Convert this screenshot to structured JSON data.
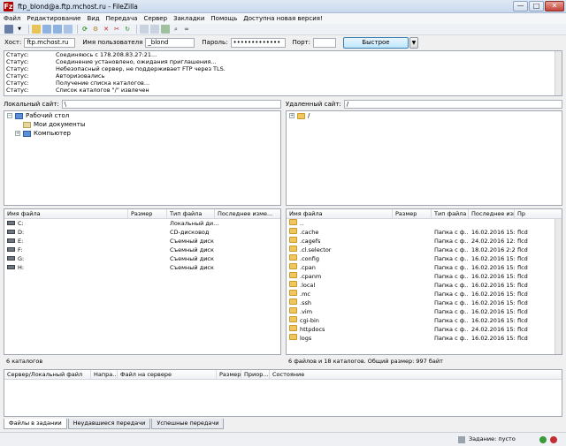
{
  "window": {
    "title": "ftp_blond@a.ftp.mchost.ru - FileZilla",
    "min": "—",
    "max": "□",
    "close": "✕"
  },
  "menu": [
    "Файл",
    "Редактирование",
    "Вид",
    "Передача",
    "Сервер",
    "Закладки",
    "Помощь",
    "Доступна новая версия!"
  ],
  "quickconnect": {
    "host_label": "Хост:",
    "host_value": "ftp.mchost.ru",
    "user_label": "Имя пользователя",
    "user_value": "_blond",
    "pass_label": "Пароль:",
    "pass_value": "•••••••••••••",
    "port_label": "Порт:",
    "port_value": "",
    "button": "Быстрое соединение",
    "dropdown": "▼"
  },
  "log": [
    {
      "label": "Статус:",
      "text": "Соединяюсь с 178.208.83.27:21..."
    },
    {
      "label": "Статус:",
      "text": "Соединение установлено, ожидания приглашения..."
    },
    {
      "label": "Статус:",
      "text": "Небезопасный сервер, не поддерживает FTP через TLS."
    },
    {
      "label": "Статус:",
      "text": "Авторизовались"
    },
    {
      "label": "Статус:",
      "text": "Получение списка каталогов..."
    },
    {
      "label": "Статус:",
      "text": "Список каталогов \"/\" извлечен"
    }
  ],
  "local": {
    "label": "Локальный сайт:",
    "path": "\\",
    "tree": [
      "Рабочий стол",
      "Мои документы",
      "Компьютер"
    ],
    "columns": [
      "Имя файла",
      "Размер",
      "Тип файла",
      "Последнее изме..."
    ],
    "files": [
      {
        "name": "C:",
        "type": "Локальный ди..."
      },
      {
        "name": "D:",
        "type": "CD-дисковод"
      },
      {
        "name": "E:",
        "type": "Съемный диск"
      },
      {
        "name": "F:",
        "type": "Съемный диск"
      },
      {
        "name": "G:",
        "type": "Съемный диск"
      },
      {
        "name": "H:",
        "type": "Съемный диск"
      }
    ],
    "status": "6 каталогов"
  },
  "remote": {
    "label": "Удаленный сайт:",
    "path": "/",
    "tree": [
      "/"
    ],
    "columns": [
      "Имя файла",
      "Размер",
      "Тип файла",
      "Последнее изме...",
      "Пр"
    ],
    "files": [
      {
        "name": "..",
        "type": "",
        "date": "",
        "perm": ""
      },
      {
        "name": ".cache",
        "type": "Папка с ф...",
        "date": "16.02.2016 15:1...",
        "perm": "flcd"
      },
      {
        "name": ".cagefs",
        "type": "Папка с ф...",
        "date": "24.02.2016 12:1...",
        "perm": "flcd"
      },
      {
        "name": ".cl.selector",
        "type": "Папка с ф...",
        "date": "18.02.2016 2:25...",
        "perm": "flcd"
      },
      {
        "name": ".config",
        "type": "Папка с ф...",
        "date": "16.02.2016 15:1...",
        "perm": "flcd"
      },
      {
        "name": ".cpan",
        "type": "Папка с ф...",
        "date": "16.02.2016 15:1...",
        "perm": "flcd"
      },
      {
        "name": ".cpanm",
        "type": "Папка с ф...",
        "date": "16.02.2016 15:1...",
        "perm": "flcd"
      },
      {
        "name": ".local",
        "type": "Папка с ф...",
        "date": "16.02.2016 15:1...",
        "perm": "flcd"
      },
      {
        "name": ".mc",
        "type": "Папка с ф...",
        "date": "16.02.2016 15:1...",
        "perm": "flcd"
      },
      {
        "name": ".ssh",
        "type": "Папка с ф...",
        "date": "16.02.2016 15:1...",
        "perm": "flcd"
      },
      {
        "name": ".vim",
        "type": "Папка с ф...",
        "date": "16.02.2016 15:1...",
        "perm": "flcd"
      },
      {
        "name": "cgi-bin",
        "type": "Папка с ф...",
        "date": "16.02.2016 15:1...",
        "perm": "flcd"
      },
      {
        "name": "httpdocs",
        "type": "Папка с ф...",
        "date": "24.02.2016 15:1...",
        "perm": "flcd"
      },
      {
        "name": "logs",
        "type": "Папка с ф...",
        "date": "16.02.2016 15:1...",
        "perm": "flcd"
      }
    ],
    "status": "6 файлов и 18 каталогов. Общий размер: 997 байт"
  },
  "queue": {
    "columns": [
      "Сервер/Локальный файл",
      "Напра...",
      "Файл на сервере",
      "Размер",
      "Приор...",
      "Состояние"
    ]
  },
  "tabs": [
    "Файлы в задании",
    "Неудавшиеся передачи",
    "Успешные передачи"
  ],
  "statusbar": {
    "queue": "Задание: пусто"
  },
  "colors": {
    "accent": "#3c7fb1",
    "title_bg": "#dfe9f5"
  }
}
